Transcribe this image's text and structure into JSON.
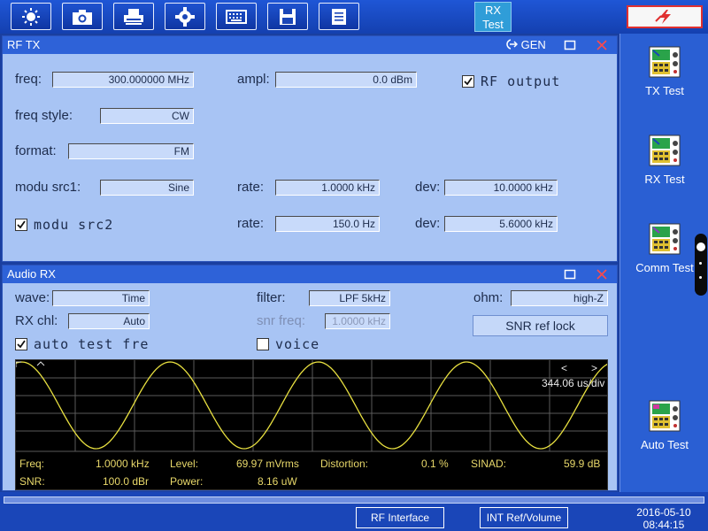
{
  "toolbar": {
    "buttons": [
      {
        "name": "brightness-icon"
      },
      {
        "name": "camera-icon"
      },
      {
        "name": "printer-icon"
      },
      {
        "name": "gear-icon"
      },
      {
        "name": "keyboard-icon"
      },
      {
        "name": "save-icon"
      },
      {
        "name": "document-icon"
      }
    ],
    "active_tab": "RX\nTest",
    "active_tab_line1": "RX",
    "active_tab_line2": "Test",
    "alarm_icon": "warning-flash-icon"
  },
  "sidebar": {
    "items": [
      {
        "label": "TX Test",
        "icon": "tx-test-icon"
      },
      {
        "label": "RX Test",
        "icon": "rx-test-icon"
      },
      {
        "label": "Comm Test",
        "icon": "comm-test-icon"
      },
      {
        "label": "Auto Test",
        "icon": "auto-test-icon"
      }
    ]
  },
  "rf_tx": {
    "title": "RF TX",
    "gen_label": "GEN",
    "freq_label": "freq:",
    "freq_value": "300.000000 MHz",
    "ampl_label": "ampl:",
    "ampl_value": "0.0 dBm",
    "rf_output_label": "RF output",
    "rf_output_checked": true,
    "freq_style_label": "freq style:",
    "freq_style_value": "CW",
    "format_label": "format:",
    "format_value": "FM",
    "modu_src1_label": "modu src1:",
    "modu_src1_value": "Sine",
    "rate1_label": "rate:",
    "rate1_value": "1.0000 kHz",
    "dev1_label": "dev:",
    "dev1_value": "10.0000 kHz",
    "modu_src2_label": "modu src2",
    "modu_src2_checked": true,
    "rate2_label": "rate:",
    "rate2_value": "150.0  Hz",
    "dev2_label": "dev:",
    "dev2_value": "5.6000 kHz"
  },
  "audio_rx": {
    "title": "Audio RX",
    "wave_label": "wave:",
    "wave_value": "Time",
    "filter_label": "filter:",
    "filter_value": "LPF 5kHz",
    "ohm_label": "ohm:",
    "ohm_value": "high-Z",
    "rx_chl_label": "RX chl:",
    "rx_chl_value": "Auto",
    "snr_freq_label": "snr freq:",
    "snr_freq_value": "1.0000 kHz",
    "snr_ref_lock_label": "SNR ref lock",
    "auto_test_label": "auto test fre",
    "auto_test_checked": true,
    "voice_label": "voice",
    "voice_checked": false,
    "scope": {
      "prev_label": "<",
      "next_label": ">",
      "timebase": "344.06 us/div",
      "cycles": 4
    },
    "measurements": {
      "freq_label": "Freq:",
      "freq_value": "1.0000 kHz",
      "level_label": "Level:",
      "level_value": "69.97 mVrms",
      "distortion_label": "Distortion:",
      "distortion_value": "0.1 %",
      "sinad_label": "SINAD:",
      "sinad_value": "59.9 dB",
      "snr_label": "SNR:",
      "snr_value": "100.0 dBr",
      "power_label": "Power:",
      "power_value": "8.16 uW"
    }
  },
  "bottom": {
    "rf_interface_label": "RF Interface",
    "int_ref_label": "INT Ref/Volume",
    "date": "2016-05-10",
    "time": "08:44:15"
  },
  "colors": {
    "toolbar_blue": "#1f56d6",
    "panel_bg": "#a8c4f4",
    "title_blue": "#2e62d8",
    "trace_yellow": "#e8e040",
    "alarm_red": "#e03030",
    "active_tab": "#2f9dd8"
  }
}
